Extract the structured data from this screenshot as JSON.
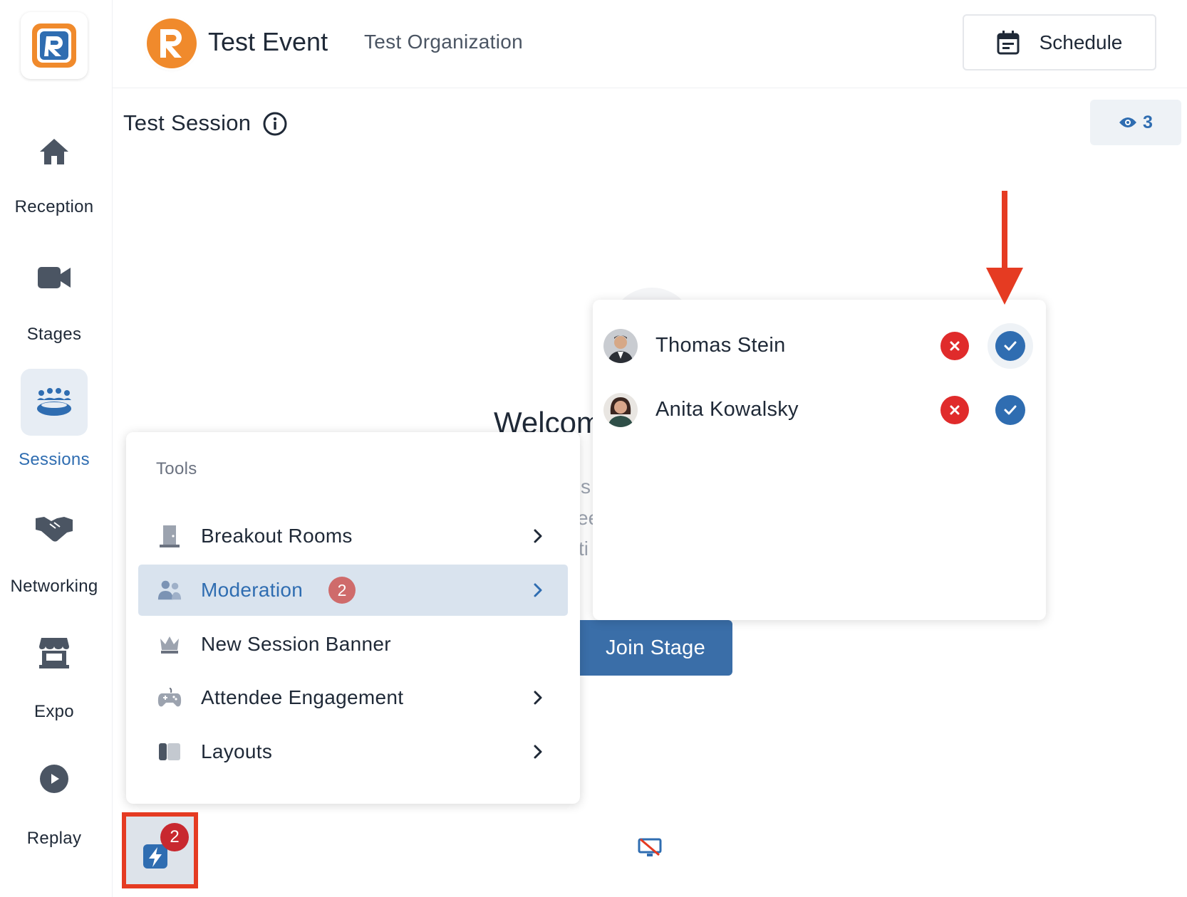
{
  "sidebar": {
    "items": [
      {
        "label": "Reception",
        "icon": "home-icon"
      },
      {
        "label": "Stages",
        "icon": "video-camera-icon"
      },
      {
        "label": "Sessions",
        "icon": "people-group-icon",
        "active": true
      },
      {
        "label": "Networking",
        "icon": "handshake-icon"
      },
      {
        "label": "Expo",
        "icon": "storefront-icon"
      },
      {
        "label": "Replay",
        "icon": "play-circle-icon"
      }
    ]
  },
  "header": {
    "event_title": "Test Event",
    "organization": "Test Organization",
    "schedule_label": "Schedule"
  },
  "session": {
    "title": "Test Session",
    "viewer_count": "3"
  },
  "stage": {
    "welcome_text": "Welcom",
    "fragment_1": "s",
    "fragment_2": "ee",
    "fragment_3": "ti",
    "join_label": "Join Stage"
  },
  "moderation": {
    "requests": [
      {
        "name": "Thomas Stein"
      },
      {
        "name": "Anita Kowalsky"
      }
    ]
  },
  "tools": {
    "heading": "Tools",
    "items": [
      {
        "label": "Breakout Rooms",
        "icon": "door-icon",
        "has_submenu": true
      },
      {
        "label": "Moderation",
        "icon": "users-icon",
        "badge": "2",
        "has_submenu": true,
        "active": true
      },
      {
        "label": "New Session Banner",
        "icon": "crown-icon",
        "has_submenu": false
      },
      {
        "label": "Attendee Engagement",
        "icon": "gamepad-icon",
        "has_submenu": true
      },
      {
        "label": "Layouts",
        "icon": "layout-icon",
        "has_submenu": true
      }
    ],
    "toggle_badge": "2"
  },
  "colors": {
    "accent": "#2f6db1",
    "brand_orange": "#f08a2c",
    "reject_red": "#e02b2b",
    "annotation_red": "#e53b22"
  }
}
